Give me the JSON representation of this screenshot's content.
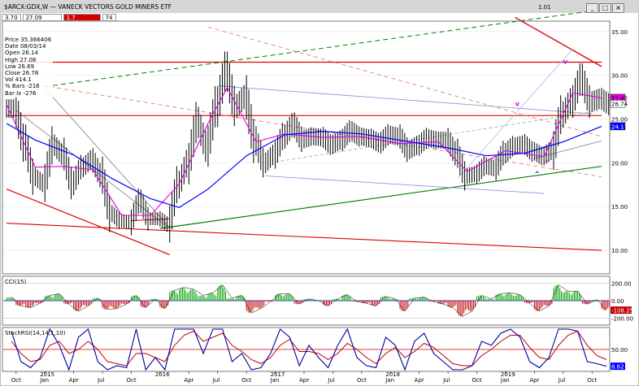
{
  "window": {
    "title": "$ARCX:GDX,W — VANECK VECTORS GOLD MINERS ETF",
    "header_value": "1.01",
    "buttons": [
      "_",
      "□",
      "×"
    ]
  },
  "toolbar": {
    "fields": [
      "3.70",
      "27.09",
      "1.7",
      "74"
    ],
    "field_colors": [
      "#ffffff",
      "#ffffff",
      "#d40000",
      "#ffffff"
    ]
  },
  "info": [
    "Price  35.366406",
    "Date   08/03/14",
    "Open   26.14",
    "High   27.08",
    "Low    26.69",
    "Close  26.78",
    "Vol    414.1",
    "% Bars -216",
    "Bar Ix -276"
  ],
  "colors": {
    "background": "#ffffff",
    "price_bars": "#000000",
    "ma_short": "#e000e0",
    "ma_long": "#0000ff",
    "cci_up": "#00a000",
    "cci_down": "#c00000",
    "stoch_k": "#0000a0",
    "stoch_d": "#c00000",
    "resistance": "#e00000",
    "support": "#008000"
  },
  "chart_data": [
    {
      "type": "line",
      "title": "$ARCX:GDX,W — VANECK VECTORS GOLD MINERS ETF",
      "y_axis": {
        "ticks": [
          10.0,
          15.0,
          20.0,
          25.0,
          30.0,
          35.0
        ],
        "ylim": [
          7.5,
          36
        ],
        "scale": "linear",
        "position": "right"
      },
      "x_axis": {
        "ticks": [
          "Oct",
          "2015",
          "Jan",
          "Apr",
          "Jul",
          "Oct",
          "2016",
          "Apr",
          "Jul",
          "Oct",
          "2017",
          "Jan",
          "Apr",
          "Jul",
          "Oct",
          "2018",
          "Jan",
          "Apr",
          "Jul",
          "Oct",
          "2019",
          "Jan",
          "Apr",
          "Jul",
          "Oct"
        ],
        "range": [
          "2014-09",
          "2019-11"
        ]
      },
      "series": [
        {
          "type": "ohlc",
          "values": [
            [
              "2014-09",
              26.2
            ],
            [
              "2014-10",
              22.3
            ],
            [
              "2014-11",
              18.4
            ],
            [
              "2014-12",
              17.7
            ],
            [
              "2015-01",
              22.0
            ],
            [
              "2015-02",
              21.0
            ],
            [
              "2015-03",
              17.7
            ],
            [
              "2015-04",
              19.5
            ],
            [
              "2015-05",
              20.3
            ],
            [
              "2015-06",
              18.6
            ],
            [
              "2015-07",
              14.2
            ],
            [
              "2015-08",
              13.4
            ],
            [
              "2015-09",
              13.2
            ],
            [
              "2015-10",
              15.6
            ],
            [
              "2015-11",
              13.6
            ],
            [
              "2015-12",
              13.6
            ],
            [
              "2016-01",
              13.0
            ],
            [
              "2016-02",
              17.5
            ],
            [
              "2016-03",
              19.9
            ],
            [
              "2016-04",
              24.6
            ],
            [
              "2016-05",
              21.9
            ],
            [
              "2016-06",
              26.4
            ],
            [
              "2016-07",
              30.4
            ],
            [
              "2016-08",
              26.5
            ],
            [
              "2016-09",
              27.5
            ],
            [
              "2016-10",
              22.5
            ],
            [
              "2016-11",
              20.0
            ],
            [
              "2016-12",
              20.9
            ],
            [
              "2017-01",
              23.0
            ],
            [
              "2017-02",
              24.3
            ],
            [
              "2017-03",
              22.7
            ],
            [
              "2017-04",
              23.0
            ],
            [
              "2017-05",
              22.9
            ],
            [
              "2017-06",
              22.1
            ],
            [
              "2017-07",
              22.6
            ],
            [
              "2017-08",
              23.6
            ],
            [
              "2017-09",
              23.0
            ],
            [
              "2017-10",
              22.8
            ],
            [
              "2017-11",
              22.3
            ],
            [
              "2017-12",
              23.2
            ],
            [
              "2018-01",
              23.0
            ],
            [
              "2018-02",
              21.5
            ],
            [
              "2018-03",
              22.0
            ],
            [
              "2018-04",
              22.8
            ],
            [
              "2018-05",
              22.6
            ],
            [
              "2018-06",
              22.6
            ],
            [
              "2018-07",
              21.1
            ],
            [
              "2018-08",
              18.5
            ],
            [
              "2018-09",
              18.7
            ],
            [
              "2018-10",
              19.6
            ],
            [
              "2018-11",
              19.4
            ],
            [
              "2018-12",
              21.1
            ],
            [
              "2019-01",
              21.9
            ],
            [
              "2019-02",
              22.1
            ],
            [
              "2019-03",
              21.3
            ],
            [
              "2019-04",
              20.8
            ],
            [
              "2019-05",
              21.4
            ],
            [
              "2019-06",
              25.5
            ],
            [
              "2019-07",
              27.0
            ],
            [
              "2019-08",
              29.5
            ],
            [
              "2019-09",
              27.0
            ],
            [
              "2019-10",
              27.3
            ],
            [
              "2019-11",
              26.7
            ]
          ]
        },
        {
          "type": "ma_short",
          "values": [
            [
              "2014-09",
              26.7
            ],
            [
              "2014-12",
              19.5
            ],
            [
              "2015-03",
              19.6
            ],
            [
              "2015-06",
              19.2
            ],
            [
              "2015-09",
              14.0
            ],
            [
              "2015-12",
              14.0
            ],
            [
              "2016-03",
              17.6
            ],
            [
              "2016-06",
              24.5
            ],
            [
              "2016-08",
              28.6
            ],
            [
              "2016-11",
              22.4
            ],
            [
              "2017-02",
              23.3
            ],
            [
              "2017-06",
              22.9
            ],
            [
              "2017-10",
              23.0
            ],
            [
              "2018-02",
              22.2
            ],
            [
              "2018-06",
              22.4
            ],
            [
              "2018-09",
              19.0
            ],
            [
              "2019-01",
              21.4
            ],
            [
              "2019-05",
              20.7
            ],
            [
              "2019-08",
              28.0
            ],
            [
              "2019-11",
              27.4
            ]
          ]
        },
        {
          "type": "ma_long",
          "values": [
            [
              "2014-09",
              24.5
            ],
            [
              "2014-12",
              22.6
            ],
            [
              "2015-04",
              20.9
            ],
            [
              "2015-08",
              18.2
            ],
            [
              "2015-12",
              15.9
            ],
            [
              "2016-03",
              14.9
            ],
            [
              "2016-06",
              17.0
            ],
            [
              "2016-10",
              20.8
            ],
            [
              "2017-02",
              23.2
            ],
            [
              "2017-06",
              23.6
            ],
            [
              "2017-10",
              23.3
            ],
            [
              "2018-03",
              22.4
            ],
            [
              "2018-07",
              21.7
            ],
            [
              "2018-11",
              20.8
            ],
            [
              "2019-03",
              21.1
            ],
            [
              "2019-07",
              22.4
            ],
            [
              "2019-11",
              24.17
            ]
          ]
        }
      ],
      "price_labels": [
        {
          "value": "27.42",
          "color": "#e000e0"
        },
        {
          "value": "26.74",
          "color": "#ffffff"
        },
        {
          "value": "24.17",
          "color": "#0000ff"
        }
      ],
      "annotations": [
        "v",
        "v",
        "^",
        "^"
      ]
    },
    {
      "type": "bar",
      "title": "CCI(15)",
      "y_axis": {
        "ticks": [
          "200.00",
          "0.00",
          "-200.00"
        ],
        "ylim": [
          -260,
          260
        ]
      },
      "last_value_label": "-108.25",
      "values": [
        40,
        -60,
        -80,
        -30,
        60,
        80,
        -40,
        -120,
        -60,
        30,
        -100,
        -90,
        -40,
        60,
        -80,
        20,
        -90,
        120,
        150,
        130,
        60,
        90,
        180,
        30,
        60,
        -140,
        -90,
        -10,
        80,
        80,
        -40,
        20,
        0,
        -60,
        20,
        70,
        -10,
        -30,
        -60,
        50,
        20,
        -120,
        30,
        40,
        -10,
        -40,
        -80,
        -180,
        -120,
        60,
        20,
        80,
        90,
        70,
        -30,
        -120,
        -60,
        180,
        110,
        110,
        -40,
        10,
        -108.25
      ]
    },
    {
      "type": "line",
      "title": "StochRSI(14,14,1,10)",
      "y_axis": {
        "ticks": [
          "50.00"
        ],
        "ylim": [
          0,
          100
        ]
      },
      "last_value_label": "8.62",
      "series": [
        {
          "name": "%K",
          "values": [
            95,
            20,
            5,
            30,
            100,
            60,
            0,
            80,
            100,
            20,
            0,
            10,
            5,
            100,
            0,
            30,
            0,
            100,
            100,
            100,
            40,
            100,
            100,
            20,
            40,
            0,
            5,
            40,
            100,
            80,
            10,
            60,
            30,
            5,
            60,
            100,
            30,
            10,
            5,
            80,
            60,
            0,
            70,
            90,
            40,
            20,
            0,
            0,
            10,
            70,
            60,
            90,
            100,
            80,
            20,
            5,
            30,
            100,
            100,
            95,
            20,
            15,
            8.62
          ]
        },
        {
          "name": "%D",
          "values": [
            70,
            40,
            20,
            25,
            60,
            70,
            40,
            50,
            70,
            50,
            20,
            15,
            10,
            40,
            40,
            30,
            20,
            60,
            85,
            95,
            70,
            80,
            90,
            60,
            45,
            25,
            15,
            30,
            60,
            75,
            45,
            45,
            40,
            25,
            40,
            65,
            50,
            30,
            15,
            40,
            55,
            30,
            45,
            65,
            55,
            35,
            15,
            10,
            10,
            35,
            50,
            70,
            85,
            85,
            55,
            30,
            25,
            60,
            85,
            95,
            60,
            35,
            25
          ]
        }
      ]
    }
  ]
}
